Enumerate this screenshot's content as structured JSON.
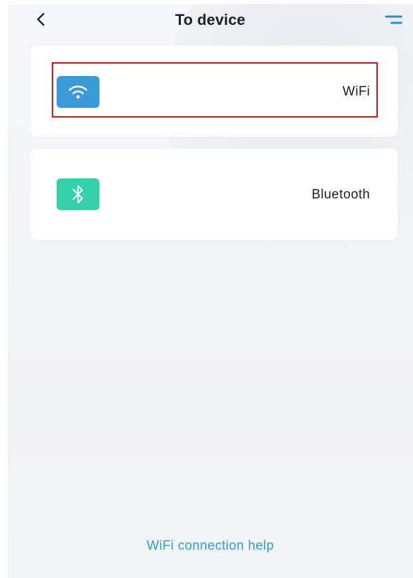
{
  "header": {
    "title": "To device",
    "back_icon": "chevron-left-icon",
    "menu_icon": "menu-icon"
  },
  "options": [
    {
      "label": "WiFi",
      "icon": "wifi-icon",
      "color": "#3a9ad8",
      "highlighted": true
    },
    {
      "label": "Bluetooth",
      "icon": "bluetooth-icon",
      "color": "#35d1aa",
      "highlighted": false
    }
  ],
  "footer": {
    "help_link": "WiFi connection help"
  },
  "colors": {
    "accent": "#2f9ed3",
    "menu_icon": "#2a8fd0",
    "highlight_border": "#d4121c"
  }
}
